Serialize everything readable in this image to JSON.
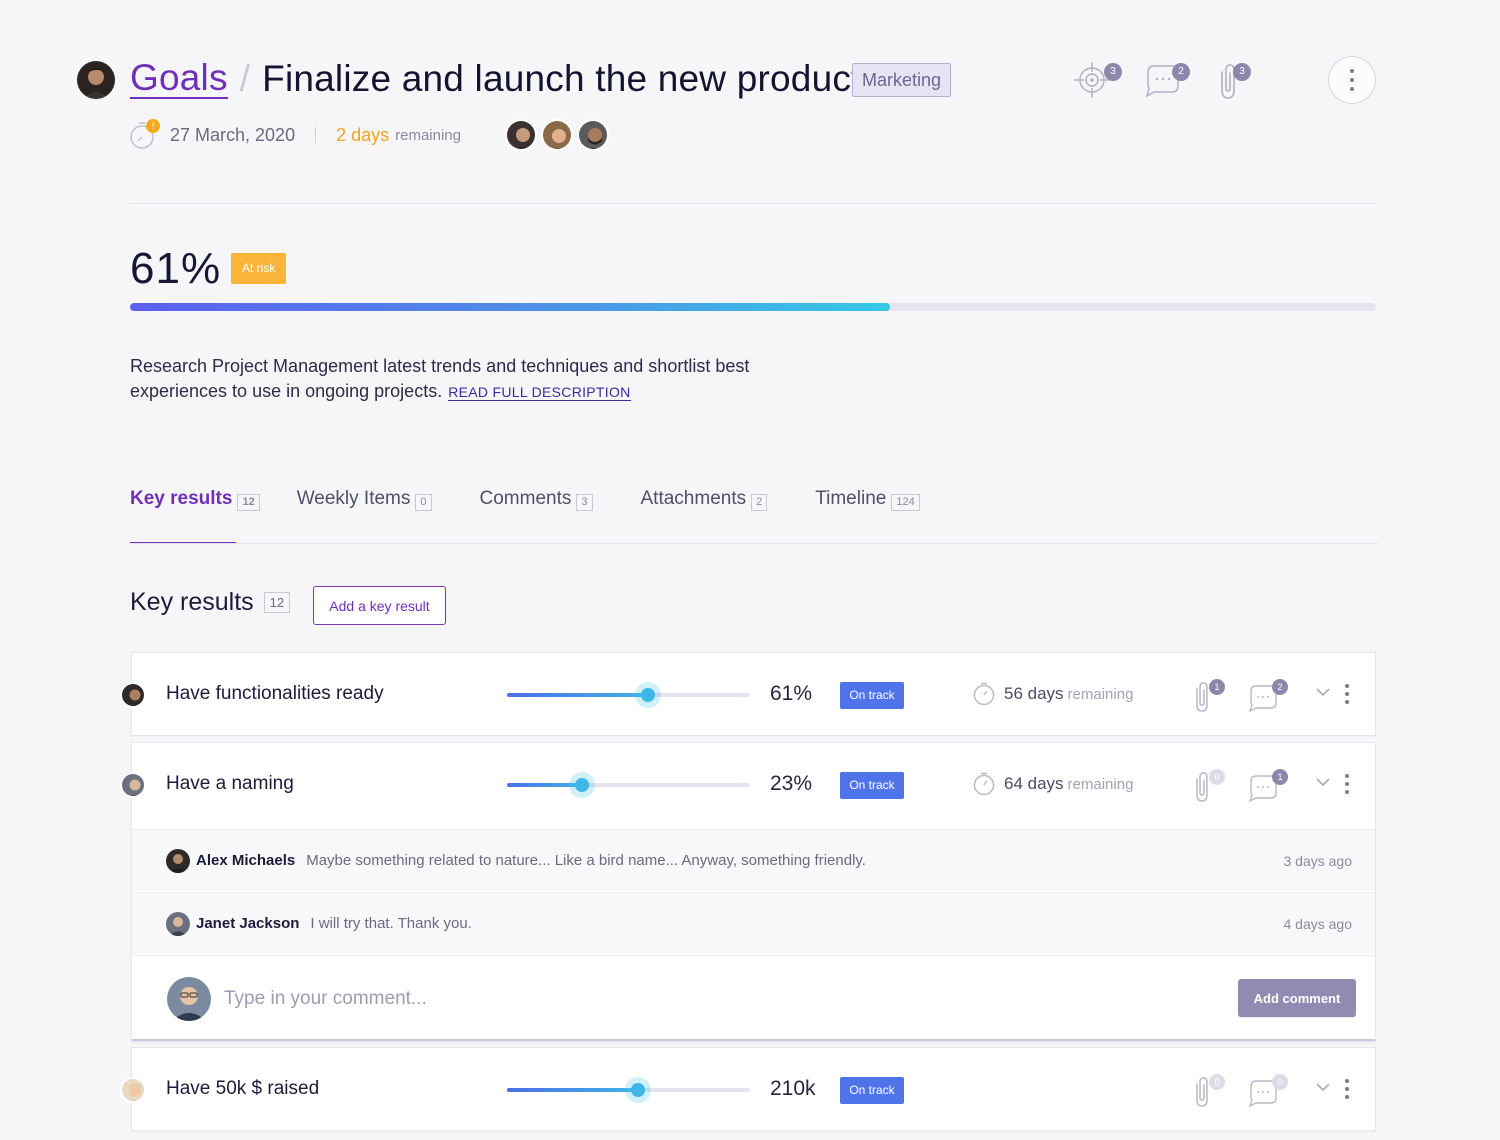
{
  "header": {
    "breadcrumb_root": "Goals",
    "breadcrumb_sep": "/",
    "title": "Finalize and launch the new product",
    "tag": "Marketing",
    "date": "27 March, 2020",
    "days": "2 days",
    "remaining": "remaining",
    "icons": [
      {
        "name": "target-icon",
        "count": "3"
      },
      {
        "name": "chat-icon",
        "count": "2"
      },
      {
        "name": "paperclip-icon",
        "count": "3"
      }
    ],
    "date_badge": "!"
  },
  "progress": {
    "percent_label": "61%",
    "percent_value": 61,
    "status": "At risk"
  },
  "description": {
    "text": "Research Project Management latest trends and techniques and shortlist best experiences to use in ongoing projects.",
    "read_more": "READ FULL DESCRIPTION"
  },
  "tabs": [
    {
      "label": "Key results",
      "count": "12"
    },
    {
      "label": "Weekly Items",
      "count": "0"
    },
    {
      "label": "Comments",
      "count": "3"
    },
    {
      "label": "Attachments",
      "count": "2"
    },
    {
      "label": "Timeline",
      "count": "124"
    }
  ],
  "section": {
    "title": "Key results",
    "count": "12",
    "add_button": "Add a key result"
  },
  "key_results": [
    {
      "title": "Have functionalities ready",
      "progress": 58,
      "value": "61%",
      "status": "On track",
      "days": "56 days",
      "remaining": "remaining",
      "attachments": "1",
      "comments": "2"
    },
    {
      "title": "Have a naming",
      "progress": 31,
      "value": "23%",
      "status": "On track",
      "days": "64 days",
      "remaining": "remaining",
      "attachments": "0",
      "comments": "1",
      "thread": [
        {
          "name": "Alex Michaels",
          "text": "Maybe something related to nature... Like a bird name... Anyway, something friendly.",
          "ago": "3 days ago"
        },
        {
          "name": "Janet Jackson",
          "text": "I will try that. Thank you.",
          "ago": "4 days ago"
        }
      ],
      "compose_placeholder": "Type in your comment...",
      "add_comment": "Add comment"
    },
    {
      "title": "Have 50k $ raised",
      "progress": 54,
      "value": "210k",
      "status": "On track",
      "attachments": "0",
      "comments": "0"
    }
  ],
  "colors": {
    "accent": "#6f2fb8",
    "at_risk": "#fbb43a",
    "on_track": "#4f74e9",
    "warning_text": "#f0a31b"
  }
}
